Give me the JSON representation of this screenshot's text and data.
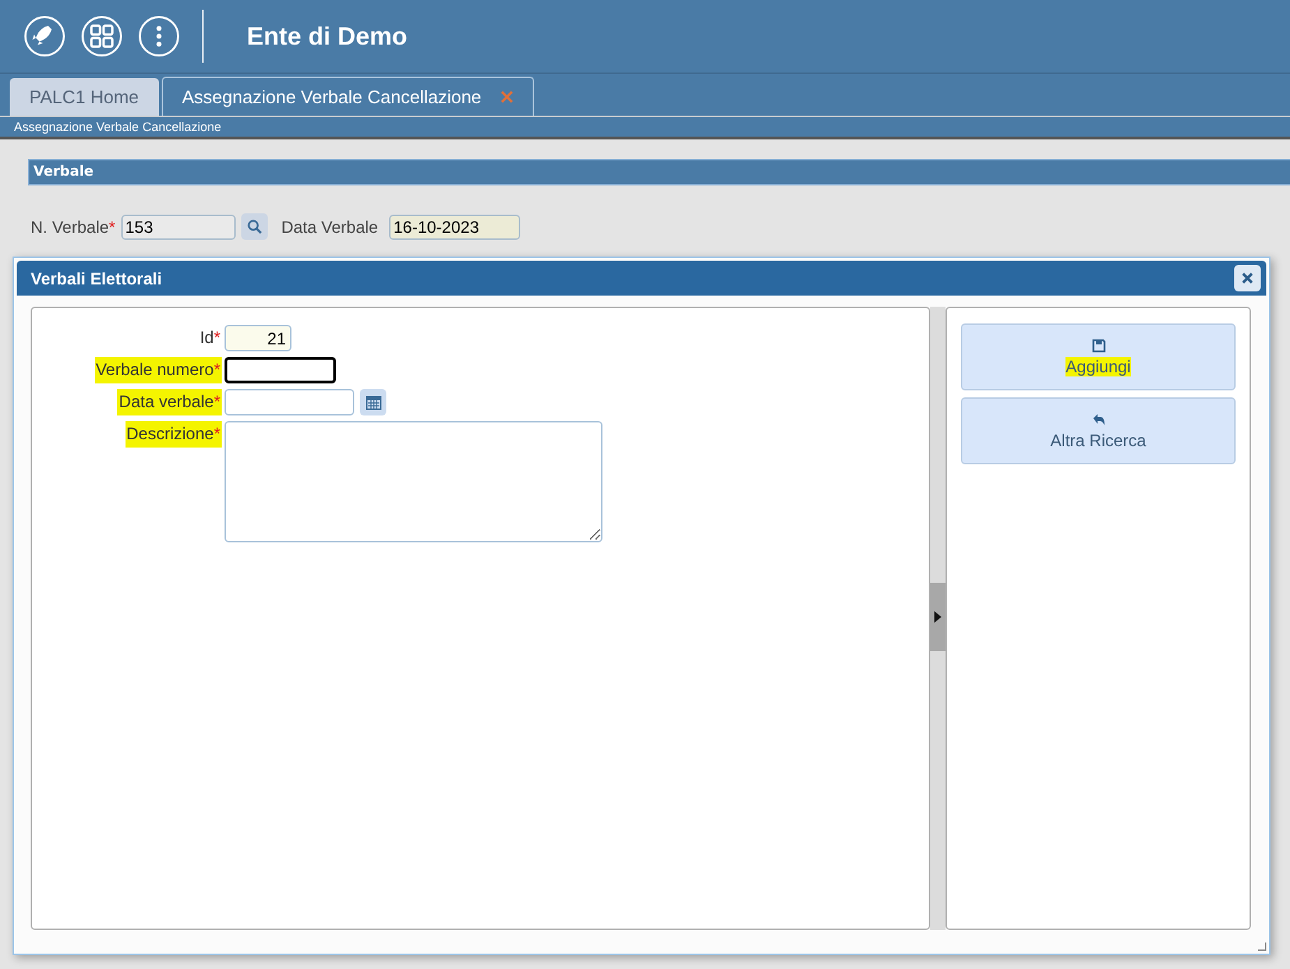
{
  "header": {
    "title": "Ente di Demo"
  },
  "tabs": [
    {
      "kind": "fixed",
      "label": "PALC1 Home",
      "selected": false
    },
    {
      "kind": "closable",
      "label": "Assegnazione Verbale Cancellazione",
      "selected": true
    }
  ],
  "breadcrumb": "Assegnazione Verbale Cancellazione",
  "panel": {
    "title": "Verbale",
    "fields": [
      {
        "kind": "search",
        "label": "N. Verbale",
        "required_mark": "*",
        "value": "153"
      },
      {
        "kind": "readonly",
        "label": "Data Verbale",
        "value": "16-10-2023"
      }
    ]
  },
  "dialog": {
    "title": "Verbali Elettorali",
    "fields": [
      {
        "kind": "number",
        "label": "Id",
        "required_mark": "*",
        "highlighted": false,
        "focused": false,
        "value": "21"
      },
      {
        "kind": "text",
        "label": "Verbale numero",
        "required_mark": "*",
        "highlighted": true,
        "focused": true
      },
      {
        "kind": "date",
        "label": "Data verbale",
        "required_mark": "*",
        "highlighted": true,
        "focused": false
      },
      {
        "kind": "textarea",
        "label": "Descrizione",
        "required_mark": "*",
        "highlighted": true,
        "focused": false
      }
    ],
    "buttons": [
      {
        "kind": "save",
        "label": "Aggiungi",
        "highlighted": true
      },
      {
        "kind": "back",
        "label": "Altra Ricerca",
        "highlighted": false
      }
    ]
  }
}
